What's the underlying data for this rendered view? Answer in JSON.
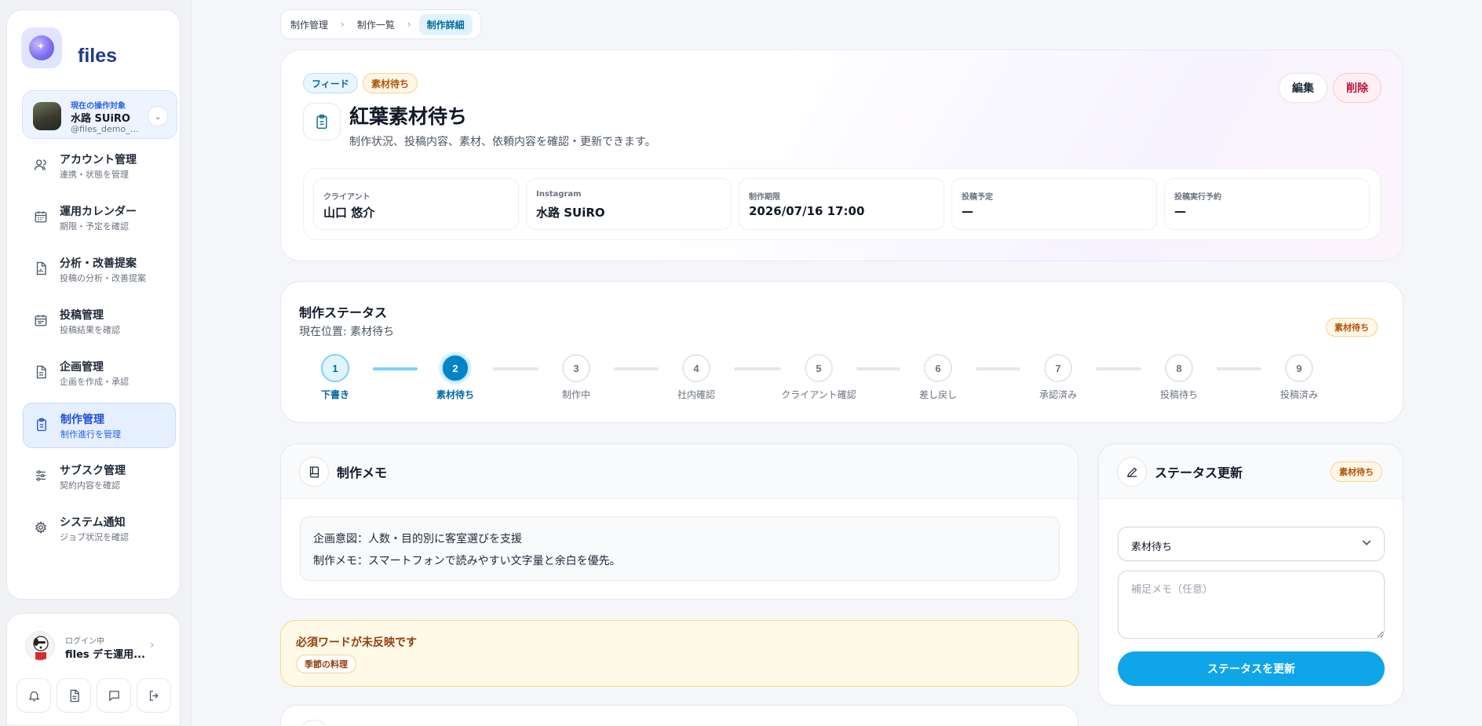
{
  "app": {
    "logo_text": "files"
  },
  "account": {
    "tag": "現在の操作対象",
    "name": "水路 SUiRO",
    "handle": "@files_demo_suiro"
  },
  "nav": [
    {
      "label": "アカウント管理",
      "sub": "連携・状態を管理",
      "icon": "users-icon"
    },
    {
      "label": "運用カレンダー",
      "sub": "期限・予定を確認",
      "icon": "calendar-icon"
    },
    {
      "label": "分析・改善提案",
      "sub": "投稿の分析・改善提案",
      "icon": "report-icon"
    },
    {
      "label": "投稿管理",
      "sub": "投稿結果を確認",
      "icon": "calendar-list-icon"
    },
    {
      "label": "企画管理",
      "sub": "企画を作成・承認",
      "icon": "document-icon"
    },
    {
      "label": "制作管理",
      "sub": "制作進行を管理",
      "icon": "clipboard-icon",
      "active": true
    },
    {
      "label": "サブスク管理",
      "sub": "契約内容を確認",
      "icon": "sliders-icon"
    },
    {
      "label": "システム通知",
      "sub": "ジョブ状況を確認",
      "icon": "gear-icon"
    }
  ],
  "user": {
    "state": "ログイン中",
    "name": "files デモ運用..."
  },
  "breadcrumb": [
    "制作管理",
    "制作一覧",
    "制作詳細"
  ],
  "header": {
    "tags": [
      "フィード",
      "素材待ち"
    ],
    "title": "紅葉素材待ち",
    "description": "制作状況、投稿内容、素材、依頼内容を確認・更新できます。",
    "edit_label": "編集",
    "delete_label": "削除"
  },
  "info": [
    {
      "label": "クライアント",
      "value": "山口 悠介"
    },
    {
      "label": "Instagram",
      "value": "水路 SUiRO"
    },
    {
      "label": "制作期限",
      "value": "2026/07/16 17:00"
    },
    {
      "label": "投稿予定",
      "value": "—"
    },
    {
      "label": "投稿実行予約",
      "value": "—"
    }
  ],
  "status": {
    "title": "制作ステータス",
    "current_text": "現在位置: 素材待ち",
    "badge": "素材待ち",
    "current_step": 2,
    "steps": [
      {
        "n": "1",
        "label": "下書き"
      },
      {
        "n": "2",
        "label": "素材待ち"
      },
      {
        "n": "3",
        "label": "制作中"
      },
      {
        "n": "4",
        "label": "社内確認"
      },
      {
        "n": "5",
        "label": "クライアント確認"
      },
      {
        "n": "6",
        "label": "差し戻し"
      },
      {
        "n": "7",
        "label": "承認済み"
      },
      {
        "n": "8",
        "label": "投稿待ち"
      },
      {
        "n": "9",
        "label": "投稿済み"
      }
    ]
  },
  "memo": {
    "title": "制作メモ",
    "lines": [
      "企画意図：人数・目的別に客室選びを支援",
      "制作メモ：スマートフォンで読みやすい文字量と余白を優先。"
    ]
  },
  "warning": {
    "title": "必須ワードが未反映です",
    "words": [
      "季節の料理"
    ]
  },
  "update": {
    "title": "ステータス更新",
    "badge": "素材待ち",
    "select_value": "素材待ち",
    "note_placeholder": "補足メモ（任意）",
    "button_label": "ステータスを更新"
  },
  "colors": {
    "accent": "#0ea5e9",
    "active_nav": "#1d4ed8",
    "pending_badge": "#b45309",
    "delete": "#be123c"
  }
}
